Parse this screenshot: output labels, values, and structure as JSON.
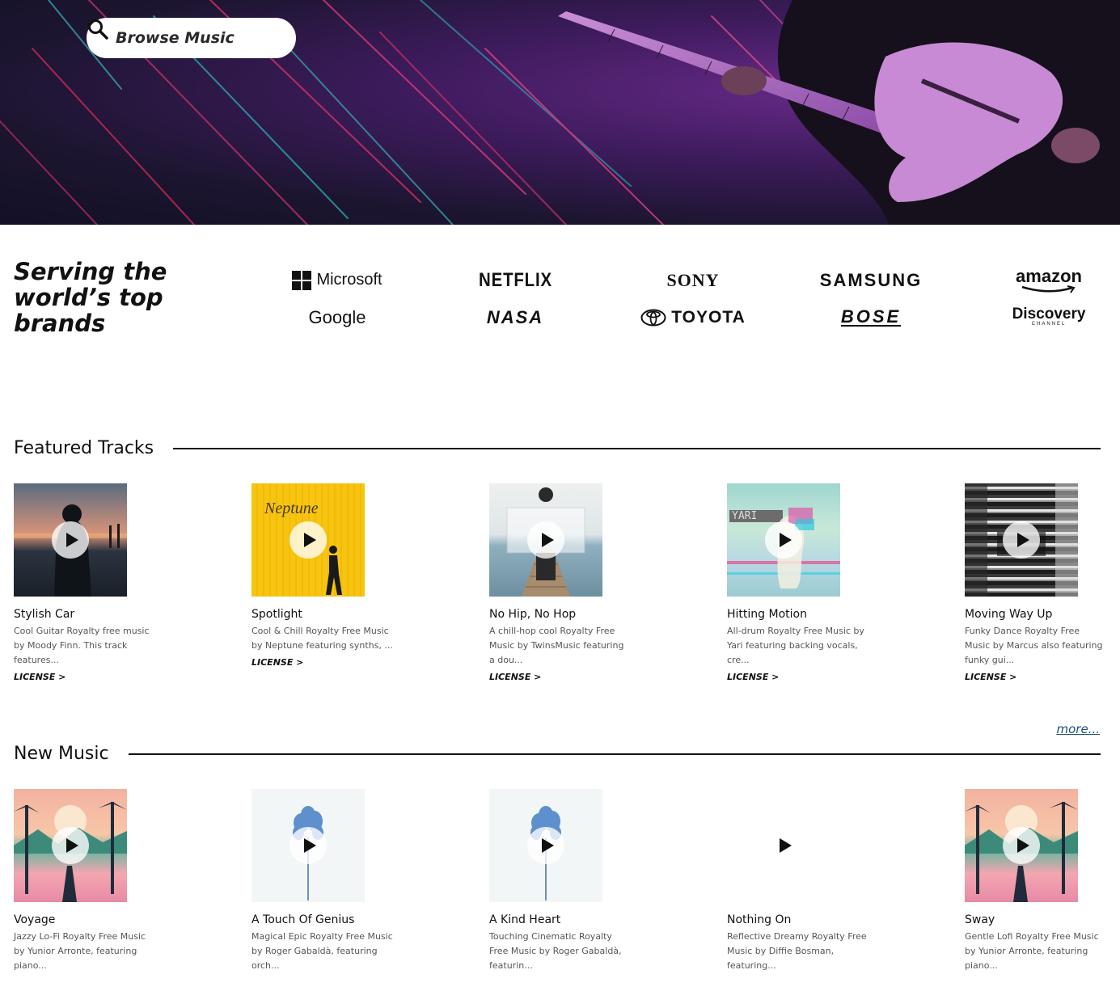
{
  "hero": {
    "browse_label": "Browse Music"
  },
  "brands": {
    "title_lines": [
      "Serving the",
      "world’s top",
      "brands"
    ],
    "logos": [
      "Microsoft",
      "NETFLIX",
      "SONY",
      "SAMSUNG",
      "amazon",
      "Google",
      "NASA",
      "TOYOTA",
      "BOSE",
      "Discovery"
    ],
    "discovery_sub": "CHANNEL"
  },
  "featured": {
    "heading": "Featured Tracks",
    "more_label": "more...",
    "tracks": [
      {
        "title": "Stylish Car",
        "desc": "Cool Guitar Royalty free music by Moody Finn. This track features...",
        "license": "LICENSE >"
      },
      {
        "title": "Spotlight",
        "desc": "Cool & Chill Royalty Free Music by Neptune featuring synths, ...",
        "license": "LICENSE >",
        "art_text": "Neptune"
      },
      {
        "title": "No Hip, No Hop",
        "desc": "A chill-hop cool Royalty Free Music by TwinsMusic featuring a dou...",
        "license": "LICENSE >"
      },
      {
        "title": "Hitting Motion",
        "desc": "All-drum Royalty Free Music by Yari featuring backing vocals, cre...",
        "license": "LICENSE >",
        "art_text": "YARI"
      },
      {
        "title": "Moving Way Up",
        "desc": "Funky Dance Royalty Free Music by Marcus also featuring funky gui...",
        "license": "LICENSE >"
      }
    ]
  },
  "new_music": {
    "heading": "New Music",
    "tracks": [
      {
        "title": "Voyage",
        "desc": "Jazzy Lo-Fi Royalty Free Music by Yunior Arronte, featuring piano..."
      },
      {
        "title": "A Touch Of Genius",
        "desc": "Magical Epic Royalty Free Music by Roger Gabaldà, featuring orch..."
      },
      {
        "title": "A Kind Heart",
        "desc": "Touching Cinematic Royalty Free Music by Roger Gabaldà, featurin..."
      },
      {
        "title": "Nothing On",
        "desc": "Reflective Dreamy Royalty Free Music by Diffie Bosman, featuring..."
      },
      {
        "title": "Sway",
        "desc": "Gentle Lofi Royalty Free Music by Yunior Arronte, featuring piano..."
      }
    ]
  }
}
